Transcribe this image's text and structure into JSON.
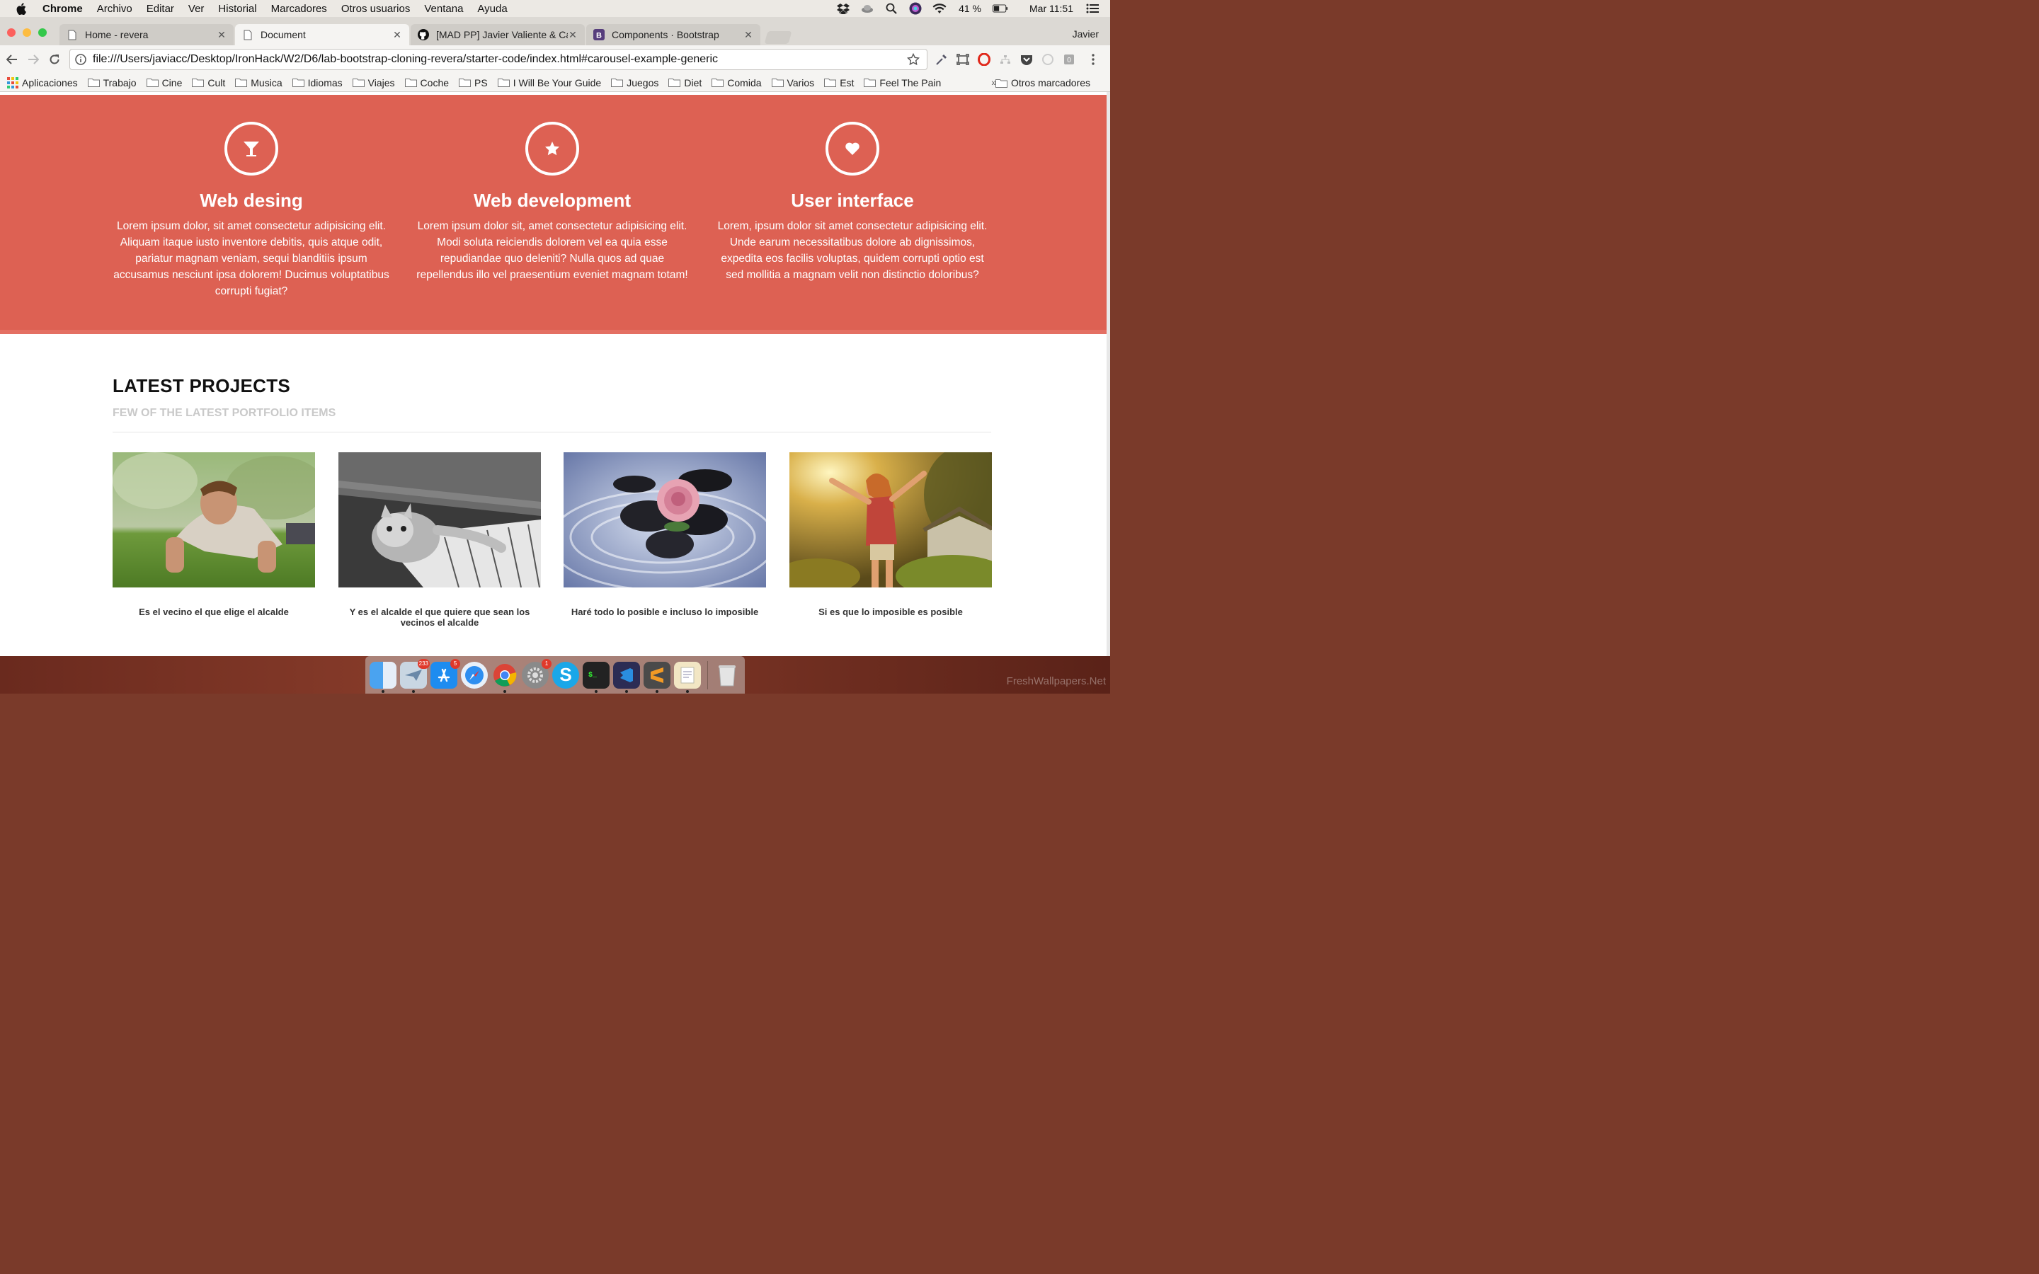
{
  "menubar": {
    "app": "Chrome",
    "items": [
      "Archivo",
      "Editar",
      "Ver",
      "Historial",
      "Marcadores",
      "Otros usuarios",
      "Ventana",
      "Ayuda"
    ],
    "battery": "41 %",
    "clock": "Mar 11:51"
  },
  "tabs": [
    {
      "title": "Home - revera",
      "active": false
    },
    {
      "title": "Document",
      "active": true
    },
    {
      "title": "[MAD PP] Javier Valiente & Ca",
      "active": false
    },
    {
      "title": "Components · Bootstrap",
      "active": false
    }
  ],
  "profile": "Javier",
  "omnibox": {
    "url": "file:///Users/javiacc/Desktop/IronHack/W2/D6/lab-bootstrap-cloning-revera/starter-code/index.html#carousel-example-generic"
  },
  "bookmarks": {
    "apps": "Aplicaciones",
    "folders": [
      "Trabajo",
      "Cine",
      "Cult",
      "Musica",
      "Idiomas",
      "Viajes",
      "Coche",
      "PS",
      "I Will Be Your Guide",
      "Juegos",
      "Diet",
      "Comida",
      "Varios",
      "Est",
      "Feel The Pain"
    ],
    "more": "»",
    "other": "Otros marcadores"
  },
  "features": [
    {
      "icon": "glass-icon",
      "title": "Web desing",
      "text": "Lorem ipsum dolor, sit amet consectetur adipisicing elit. Aliquam itaque iusto inventore debitis, quis atque odit, pariatur magnam veniam, sequi blanditiis ipsum accusamus nesciunt ipsa dolorem! Ducimus voluptatibus corrupti fugiat?"
    },
    {
      "icon": "star-icon",
      "title": "Web development",
      "text": "Lorem ipsum dolor sit, amet consectetur adipisicing elit. Modi soluta reiciendis dolorem vel ea quia esse repudiandae quo deleniti? Nulla quos ad quae repellendus illo vel praesentium eveniet magnam totam!"
    },
    {
      "icon": "heart-icon",
      "title": "User interface",
      "text": "Lorem, ipsum dolor sit amet consectetur adipisicing elit. Unde earum necessitatibus dolore ab dignissimos, expedita eos facilis voluptas, quidem corrupti optio est sed mollitia a magnam velit non distinctio doloribus?"
    }
  ],
  "latest": {
    "title": "LATEST PROJECTS",
    "subtitle": "FEW OF THE LATEST PORTFOLIO ITEMS"
  },
  "projects": [
    {
      "caption": "Es el vecino el que elige el alcalde"
    },
    {
      "caption": "Y es el alcalde el que quiere que sean los vecinos el alcalde"
    },
    {
      "caption": "Haré todo lo posible e incluso lo imposible"
    },
    {
      "caption": "Si es que lo imposible es posible"
    }
  ],
  "dock": {
    "badges": {
      "mail": "233",
      "appstore": "5",
      "prefs": "1"
    }
  },
  "watermark": "FreshWallpapers.Net",
  "colors": {
    "hero": "#dd6153",
    "subtitle": "#c9c9c9"
  }
}
